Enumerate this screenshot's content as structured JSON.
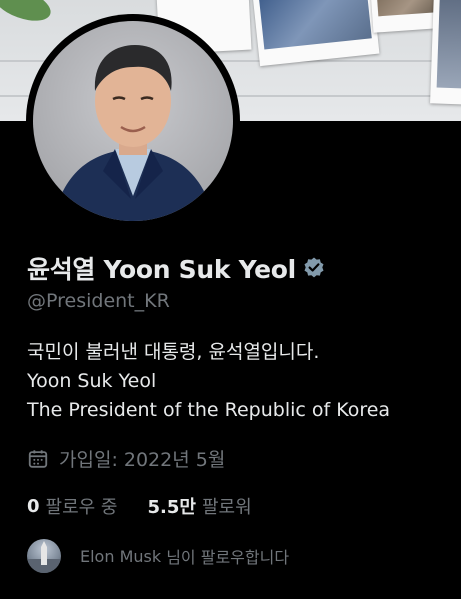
{
  "profile": {
    "name": "윤석열 Yoon Suk Yeol",
    "handle": "@President_KR",
    "bio_lines": [
      "국민이 불러낸 대통령, 윤석열입니다.",
      "Yoon Suk Yeol",
      "The President of the Republic of Korea"
    ],
    "joined": "가입일: 2022년 5월",
    "following_count": "0",
    "following_label": "팔로우 중",
    "followers_count": "5.5만",
    "followers_label": "팔로워",
    "followed_by_name": "Elon Musk",
    "followed_by_suffix": " 님이 팔로우합니다"
  },
  "colors": {
    "background": "#000000",
    "primary_text": "#e7e9ea",
    "secondary_text": "#71767b",
    "verified_badge": "#829aab"
  },
  "icons": {
    "verified": "verified-badge-icon",
    "calendar": "calendar-icon"
  }
}
